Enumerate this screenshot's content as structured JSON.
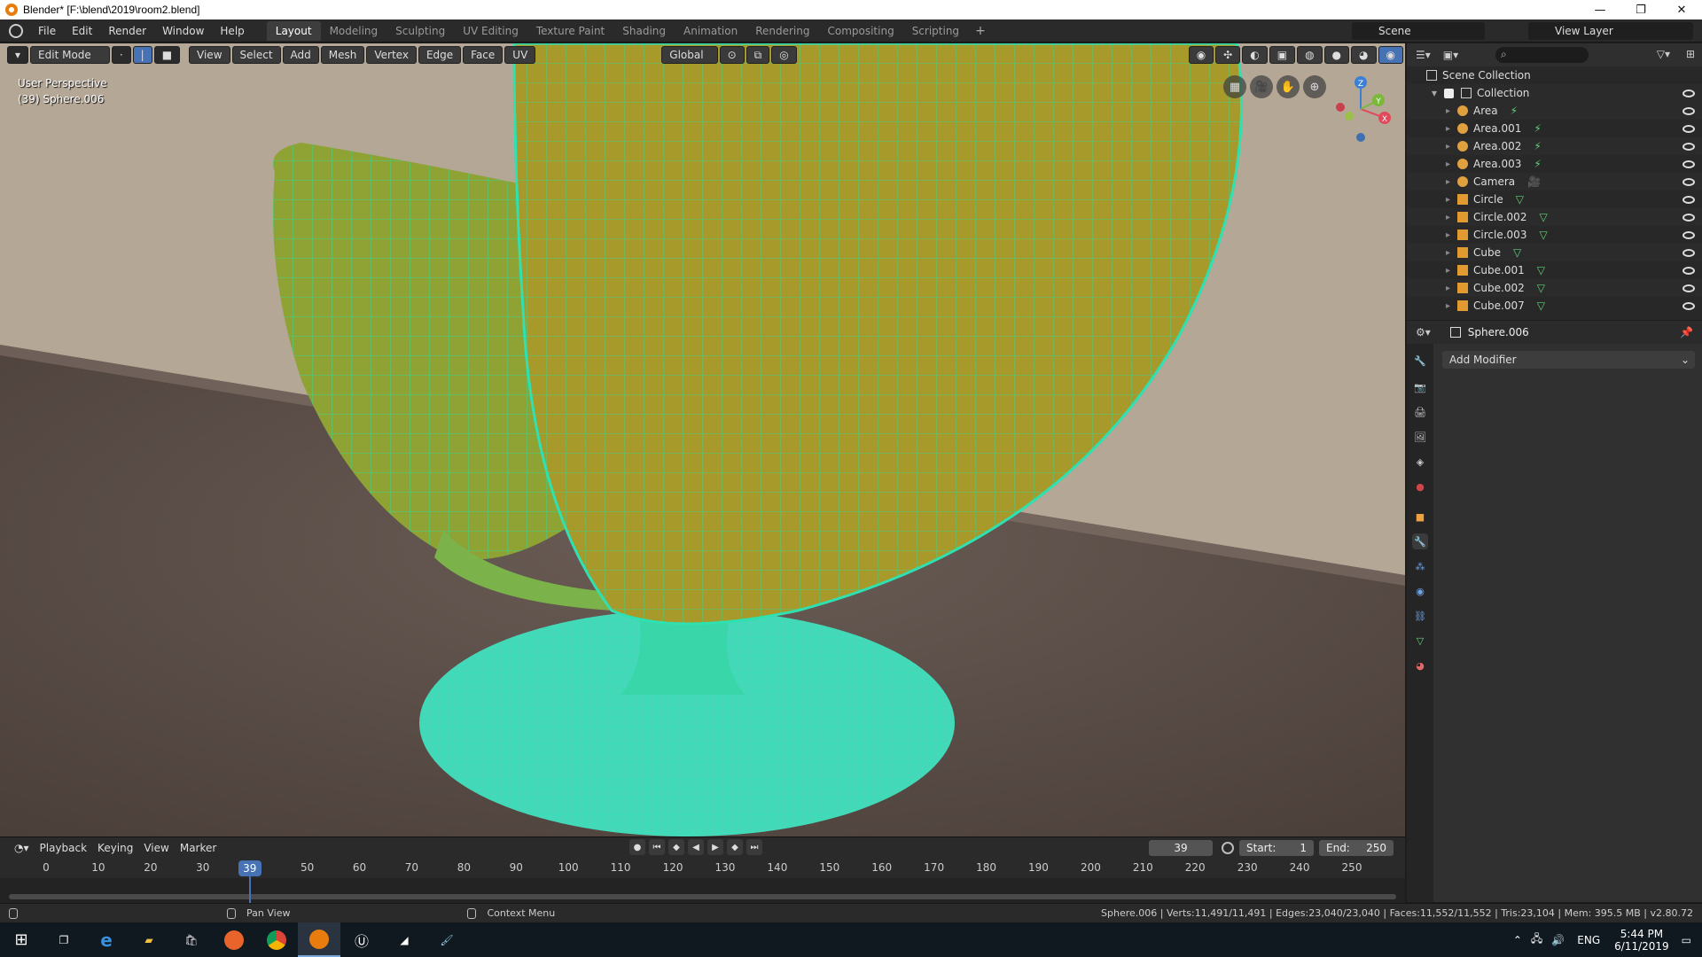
{
  "window": {
    "title": "Blender* [F:\\blend\\2019\\room2.blend]",
    "controls": [
      "—",
      "❐",
      "✕"
    ]
  },
  "menu": {
    "items": [
      "File",
      "Edit",
      "Render",
      "Window",
      "Help"
    ]
  },
  "workspaces": {
    "tabs": [
      "Layout",
      "Modeling",
      "Sculpting",
      "UV Editing",
      "Texture Paint",
      "Shading",
      "Animation",
      "Rendering",
      "Compositing",
      "Scripting"
    ],
    "active": "Layout",
    "add": "+"
  },
  "scene": {
    "name": "Scene"
  },
  "view_layer": {
    "name": "View Layer"
  },
  "viewport": {
    "mode": "Edit Mode",
    "menus": [
      "View",
      "Select",
      "Add",
      "Mesh",
      "Vertex",
      "Edge",
      "Face",
      "UV"
    ],
    "orientation": "Global",
    "perspective_label": "User Perspective",
    "object_label": "(39) Sphere.006",
    "gizmo_axes": {
      "x": "X",
      "y": "Y",
      "z": "Z"
    }
  },
  "outliner": {
    "root": "Scene Collection",
    "collection": "Collection",
    "objects": [
      {
        "name": "Area",
        "type": "light"
      },
      {
        "name": "Area.001",
        "type": "light"
      },
      {
        "name": "Area.002",
        "type": "light"
      },
      {
        "name": "Area.003",
        "type": "light"
      },
      {
        "name": "Camera",
        "type": "camera"
      },
      {
        "name": "Circle",
        "type": "mesh"
      },
      {
        "name": "Circle.002",
        "type": "mesh"
      },
      {
        "name": "Circle.003",
        "type": "mesh"
      },
      {
        "name": "Cube",
        "type": "mesh"
      },
      {
        "name": "Cube.001",
        "type": "mesh"
      },
      {
        "name": "Cube.002",
        "type": "mesh"
      },
      {
        "name": "Cube.007",
        "type": "mesh"
      }
    ]
  },
  "properties": {
    "object_name": "Sphere.006",
    "add_modifier_label": "Add Modifier"
  },
  "timeline": {
    "menus": [
      "Playback",
      "Keying",
      "View",
      "Marker"
    ],
    "current_frame": "39",
    "start_label": "Start:",
    "start_value": "1",
    "end_label": "End:",
    "end_value": "250",
    "ticks": [
      "0",
      "10",
      "20",
      "30",
      "50",
      "60",
      "70",
      "80",
      "90",
      "100",
      "110",
      "120",
      "130",
      "140",
      "150",
      "160",
      "170",
      "180",
      "190",
      "200",
      "210",
      "220",
      "230",
      "240",
      "250"
    ],
    "current_frame_value": 39
  },
  "statusbar": {
    "left_hint": "Pan View",
    "right_hint": "Context Menu",
    "stats": "Sphere.006 | Verts:11,491/11,491 | Edges:23,040/23,040 | Faces:11,552/11,552 | Tris:23,104 | Mem: 395.5 MB | v2.80.72"
  },
  "taskbar": {
    "language": "ENG",
    "time": "5:44 PM",
    "date": "6/11/2019"
  }
}
